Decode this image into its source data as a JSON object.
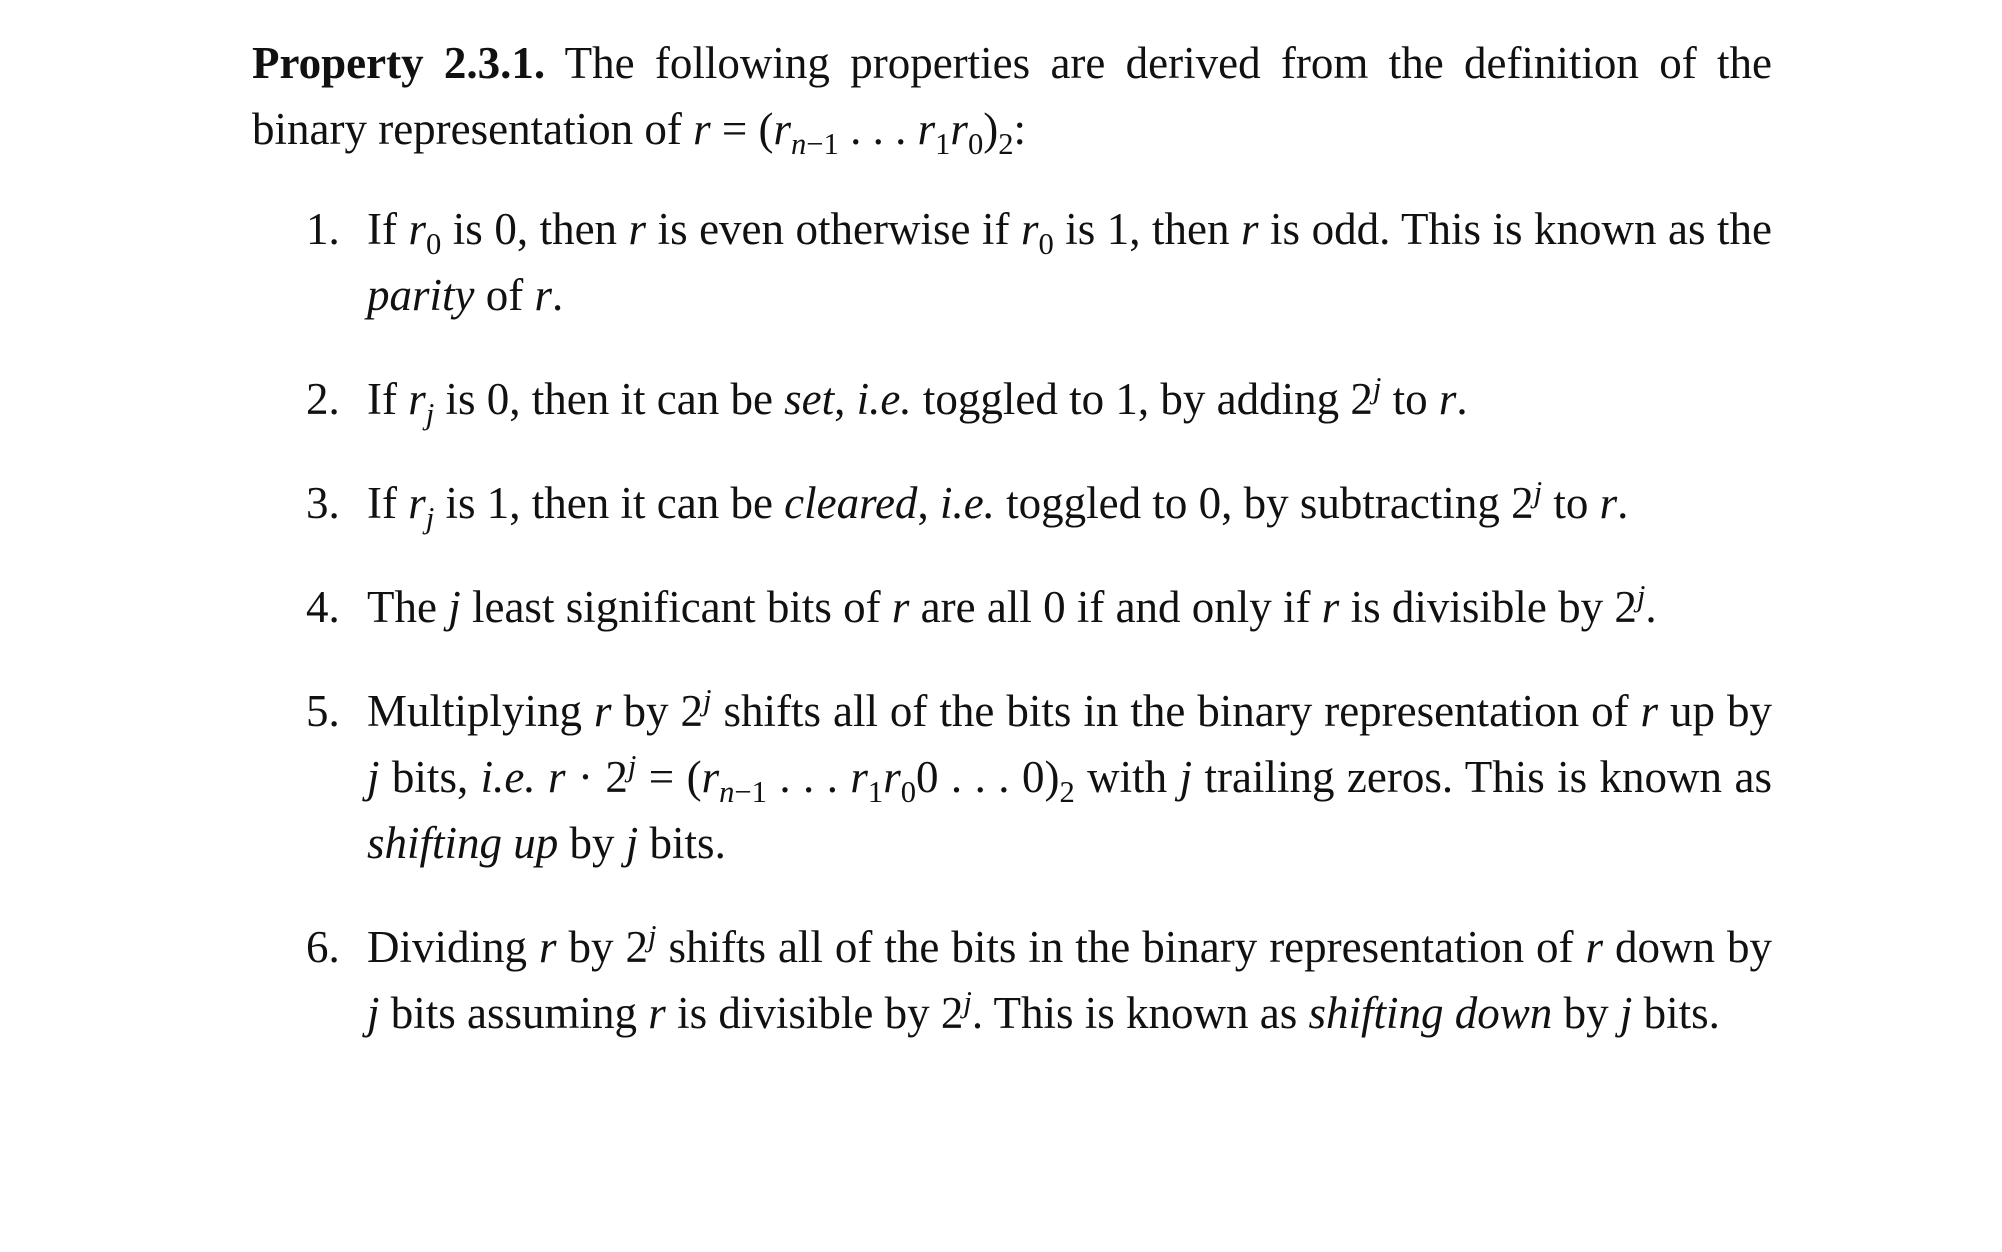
{
  "property": {
    "heading": "Property 2.3.1.",
    "intro": " The following properties are derived from the definition of the binary representation of "
  },
  "items": [
    {
      "number": "1.",
      "t1": "If ",
      "t2": " is 0, then ",
      "t3": " is even otherwise if ",
      "t4": " is 1, then ",
      "t5": " is odd. This is known as the ",
      "em1": "parity",
      "t6": " of "
    },
    {
      "number": "2.",
      "t1": "If ",
      "t2": " is 0, then it can be ",
      "em1": "set",
      "t3": ", ",
      "em2": "i.e.",
      "t4": " toggled to 1, by adding 2",
      "t5": " to "
    },
    {
      "number": "3.",
      "t1": "If ",
      "t2": " is 1, then it can be ",
      "em1": "cleared",
      "t3": ", ",
      "em2": "i.e.",
      "t4": " toggled to 0, by subtracting 2",
      "t5": " to "
    },
    {
      "number": "4.",
      "t1": "The ",
      "t2": " least significant bits of ",
      "t3": " are all 0 if and only if ",
      "t4": " is divisible by 2"
    },
    {
      "number": "5.",
      "t1": "Multiplying ",
      "t2": " by 2",
      "t3": " shifts all of the bits in the binary representation of ",
      "t4": " up by ",
      "t5": " bits, ",
      "em1": "i.e.",
      "t6": " with ",
      "t7": " trailing zeros. This is known as ",
      "em2": "shifting up",
      "t8": " by ",
      "t9": " bits."
    },
    {
      "number": "6.",
      "t1": "Dividing ",
      "t2": " by 2",
      "t3": " shifts all of the bits in the binary representation of ",
      "t4": " down by ",
      "t5": " bits assuming ",
      "t6": " is divisible by 2",
      "t7": ". This is known as ",
      "em1": "shifting down",
      "t8": " by ",
      "t9": " bits."
    }
  ]
}
